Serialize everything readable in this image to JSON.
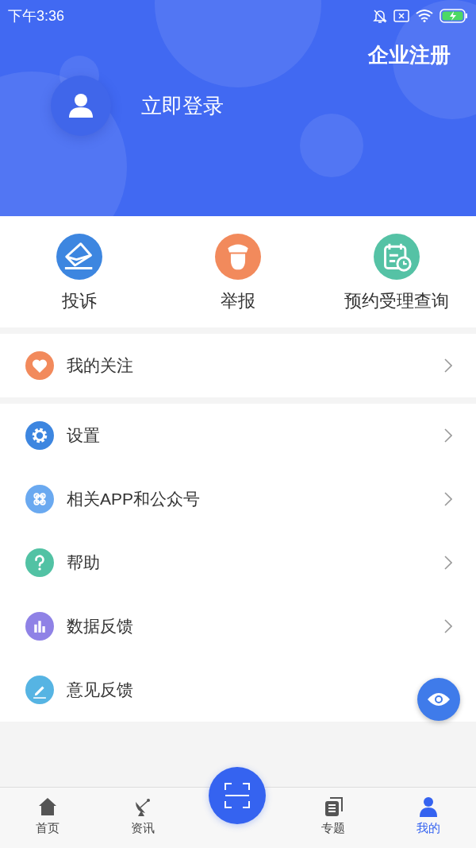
{
  "status_bar": {
    "time": "下午3:36"
  },
  "header": {
    "register_link": "企业注册",
    "login_label": "立即登录"
  },
  "quick_actions": [
    {
      "label": "投诉",
      "kind": "envelope",
      "color": "#3d86e0"
    },
    {
      "label": "举报",
      "kind": "officer",
      "color": "#f28a5c"
    },
    {
      "label": "预约受理查询",
      "kind": "calendar",
      "color": "#55c2a5"
    }
  ],
  "menu_groups": [
    [
      {
        "label": "我的关注",
        "kind": "heart",
        "color": "#f28a5c",
        "chevron": true
      }
    ],
    [
      {
        "label": "设置",
        "kind": "gear",
        "color": "#3d86e0",
        "chevron": true
      },
      {
        "label": "相关APP和公众号",
        "kind": "command",
        "color": "#6aa9f0",
        "chevron": true
      },
      {
        "label": "帮助",
        "kind": "question",
        "color": "#52c2a4",
        "chevron": true
      },
      {
        "label": "数据反馈",
        "kind": "bars",
        "color": "#8f82e6",
        "chevron": true
      },
      {
        "label": "意见反馈",
        "kind": "pencil",
        "color": "#56b4e3",
        "chevron": false
      }
    ]
  ],
  "bottom_nav": [
    {
      "label": "首页",
      "kind": "home",
      "selected": false
    },
    {
      "label": "资讯",
      "kind": "dish",
      "selected": false
    },
    {
      "label": "专题",
      "kind": "docs",
      "selected": false
    },
    {
      "label": "我的",
      "kind": "person",
      "selected": true
    }
  ]
}
